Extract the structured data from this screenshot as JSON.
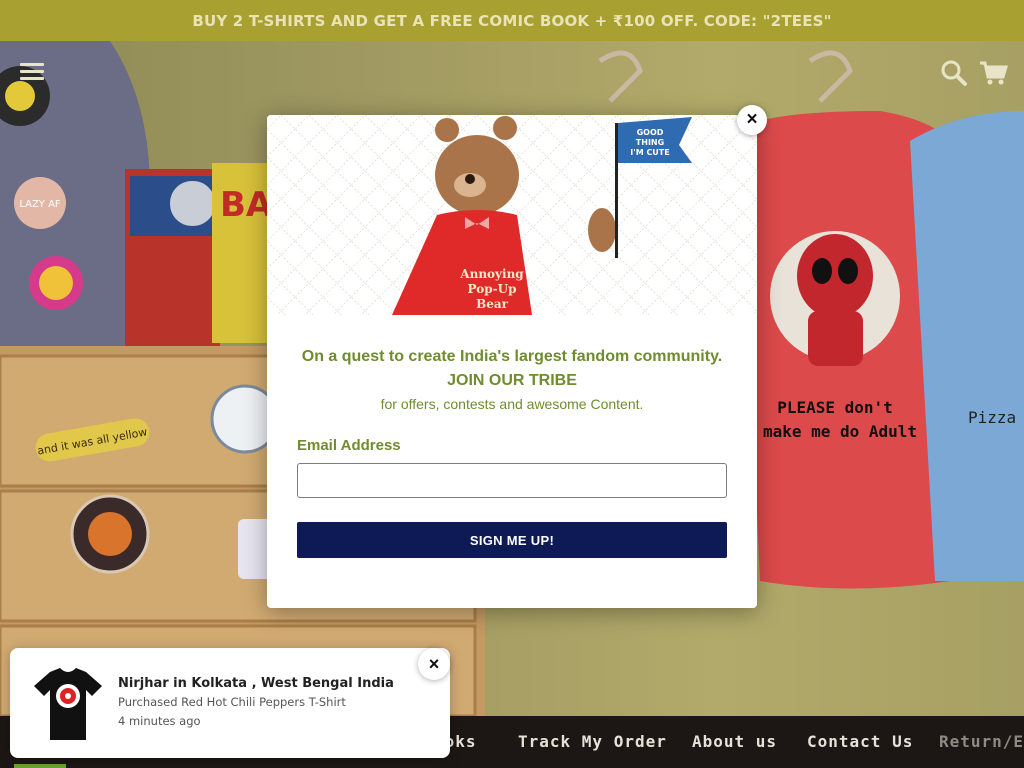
{
  "promo": {
    "text": "BUY 2 T-SHIRTS AND GET A FREE COMIC BOOK + ₹100 OFF. CODE: \"2TEES\""
  },
  "hero": {
    "icons": [
      "menu-icon",
      "search-icon",
      "cart-icon"
    ],
    "scene_text": {
      "badge": "LAZY AF",
      "sticker": "and it was all yellow",
      "shirt_caption_1": "PLEASE don't",
      "shirt_caption_2": "make me do Adult",
      "shirt_right": "Pizza"
    }
  },
  "popup": {
    "bear_label_line1": "Annoying",
    "bear_label_line2": "Pop-Up",
    "bear_label_line3": "Bear",
    "flag_line1": "GOOD",
    "flag_line2": "THING",
    "flag_line3": "I'M CUTE",
    "headline": "On a quest to create India's largest fandom community.",
    "tribe": "JOIN OUR TRIBE",
    "subtext": "for offers, contests and awesome Content.",
    "email_label": "Email Address",
    "email_value": "",
    "submit_label": "SIGN ME UP!",
    "close_icon": "×"
  },
  "nav": {
    "items": [
      "ooks",
      "Track My Order",
      "About us",
      "Contact Us",
      "Return/E"
    ]
  },
  "toast": {
    "name": "Nirjhar in Kolkata , West Bengal India",
    "product": "Purchased Red Hot Chili Peppers T-Shirt",
    "time": "4 minutes ago",
    "close_icon": "×"
  },
  "colors": {
    "promo_bg": "#a9a032",
    "accent_green": "#6f8d2e",
    "button_navy": "#0e1a55",
    "nav_bg": "#1c1715"
  }
}
